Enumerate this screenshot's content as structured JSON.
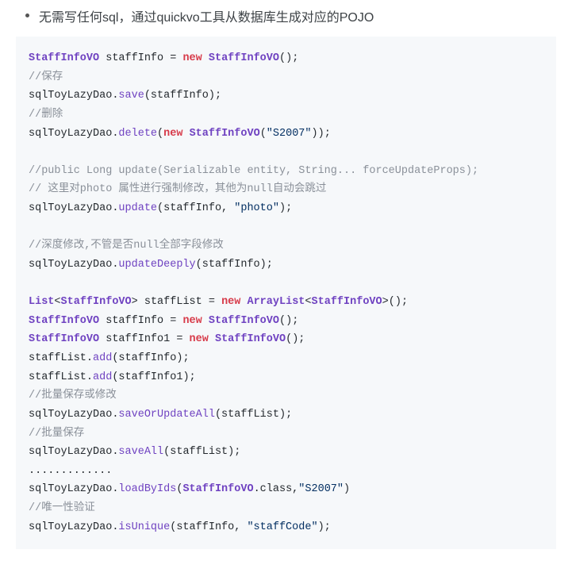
{
  "bullet": "无需写任何sql，通过quickvo工具从数据库生成对应的POJO",
  "code": {
    "l1_type": "StaffInfoVO",
    "l1_var": " staffInfo ",
    "l1_eq": "= ",
    "l1_new": "new",
    "l1_sp": " ",
    "l1_ctor": "StaffInfoVO",
    "l1_tail": "();",
    "l2_cmt": "//保存",
    "l3_a": "sqlToyLazyDao.",
    "l3_fn": "save",
    "l3_b": "(staffInfo);",
    "l4_cmt": "//删除",
    "l5_a": "sqlToyLazyDao.",
    "l5_fn": "delete",
    "l5_b": "(",
    "l5_new": "new",
    "l5_sp": " ",
    "l5_ctor": "StaffInfoVO",
    "l5_c": "(",
    "l5_str": "\"S2007\"",
    "l5_d": "));",
    "l6_cmt": "//public Long update(Serializable entity, String... forceUpdateProps);",
    "l7_cmt": "// 这里对photo 属性进行强制修改，其他为null自动会跳过",
    "l8_a": "sqlToyLazyDao.",
    "l8_fn": "update",
    "l8_b": "(staffInfo, ",
    "l8_str": "\"photo\"",
    "l8_c": ");",
    "l9_cmt": "//深度修改,不管是否null全部字段修改",
    "l10_a": "sqlToyLazyDao.",
    "l10_fn": "updateDeeply",
    "l10_b": "(staffInfo);",
    "l11_type": "List",
    "l11_a": "<",
    "l11_gen": "StaffInfoVO",
    "l11_b": "> staffList ",
    "l11_eq": "= ",
    "l11_new": "new",
    "l11_sp": " ",
    "l11_ctor": "ArrayList",
    "l11_c": "<",
    "l11_gen2": "StaffInfoVO",
    "l11_d": ">();",
    "l12_type": "StaffInfoVO",
    "l12_var": " staffInfo ",
    "l12_eq": "= ",
    "l12_new": "new",
    "l12_sp": " ",
    "l12_ctor": "StaffInfoVO",
    "l12_tail": "();",
    "l13_type": "StaffInfoVO",
    "l13_var": " staffInfo1 ",
    "l13_eq": "= ",
    "l13_new": "new",
    "l13_sp": " ",
    "l13_ctor": "StaffInfoVO",
    "l13_tail": "();",
    "l14_a": "staffList.",
    "l14_fn": "add",
    "l14_b": "(staffInfo);",
    "l15_a": "staffList.",
    "l15_fn": "add",
    "l15_b": "(staffInfo1);",
    "l16_cmt": "//批量保存或修改",
    "l17_a": "sqlToyLazyDao.",
    "l17_fn": "saveOrUpdateAll",
    "l17_b": "(staffList);",
    "l18_cmt": "//批量保存",
    "l19_a": "sqlToyLazyDao.",
    "l19_fn": "saveAll",
    "l19_b": "(staffList);",
    "l20_a": ".............",
    "l21_a": "sqlToyLazyDao.",
    "l21_fn": "loadByIds",
    "l21_b": "(",
    "l21_type": "StaffInfoVO",
    "l21_c": ".class,",
    "l21_str": "\"S2007\"",
    "l21_d": ")",
    "l22_cmt": "//唯一性验证",
    "l23_a": "sqlToyLazyDao.",
    "l23_fn": "isUnique",
    "l23_b": "(staffInfo, ",
    "l23_str": "\"staffCode\"",
    "l23_c": ");"
  }
}
